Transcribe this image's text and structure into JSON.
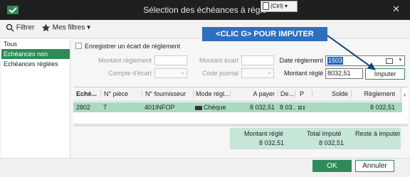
{
  "window": {
    "title": "Sélection des échéances à régle",
    "close": "✕",
    "paste_chip": "(Ctrl)"
  },
  "toolbar": {
    "filter_label": "Filtrer",
    "myfilters_label": "Mes filtres"
  },
  "annotation": "<CLIC G> POUR IMPUTER",
  "sidebar": {
    "items": [
      "Tous",
      "Echéances non réglées",
      "Echéances réglées"
    ]
  },
  "form": {
    "register_gap_label": "Enregistrer un écart de règlement",
    "montant_reglement_label": "Montant règlement",
    "compte_ecart_label": "Compte d'écart",
    "montant_ecart_label": "Montant écart",
    "code_journal_label": "Code journal",
    "date_reglement_label": "Date règlement",
    "date_reglement_value": "1503",
    "montant_regle_label": "Montant réglé",
    "montant_regle_value": "8032,51",
    "imputer_label": "Imputer"
  },
  "grid": {
    "headers": [
      "Eché...",
      "N° pièce",
      "N° fournisseur",
      "Mode régl...",
      "A payer",
      "De...",
      "P",
      "Solde",
      "Règlement"
    ],
    "row": {
      "echeance": "2802",
      "piece": "7",
      "fournisseur": "401INFOP",
      "mode": "Chèque",
      "a_payer": "8 032,51",
      "de": "8 03...",
      "solde": "",
      "reglement": "8 032,51"
    }
  },
  "totals": {
    "montant_regle_label": "Montant réglé",
    "montant_regle_value": "8 032,51",
    "total_impute_label": "Total imputé",
    "total_impute_value": "8 032,51",
    "reste_label": "Reste à imputer",
    "reste_value": ""
  },
  "footer": {
    "ok_label": "OK",
    "cancel_label": "Annuler"
  },
  "colors": {
    "accent": "#2e8b57",
    "selected_row": "#a9d9c2",
    "totals_bg": "#c6e6d7",
    "annotation_bg": "#2f6fc0",
    "titlebar": "#1f1f1f"
  }
}
